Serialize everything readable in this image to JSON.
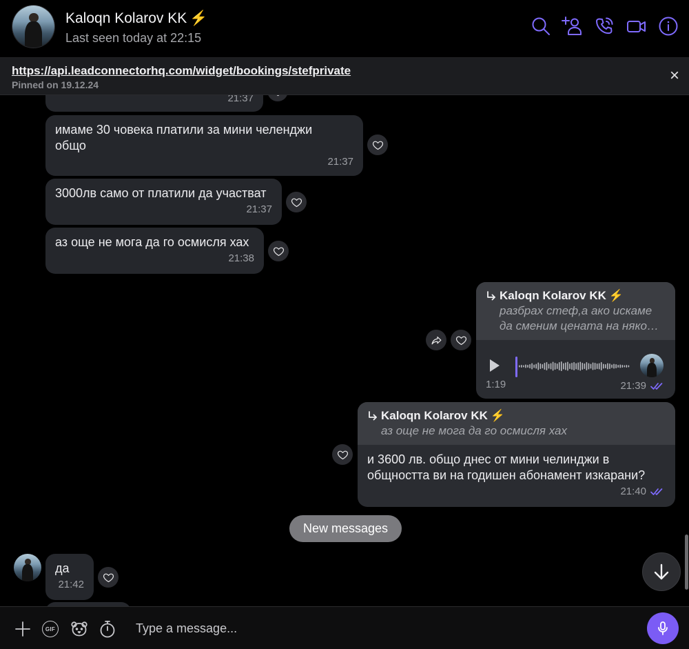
{
  "theme": {
    "accent": "#7f6bff",
    "background": "#000000",
    "incoming_bubble": "#25272c",
    "outgoing_bubble": "#2a2c31",
    "reply_block": "#3b3d42",
    "badge_color": "#f6c343",
    "mic_button": "#7b5cf5"
  },
  "header": {
    "contact_name": "Kaloqn Kolarov KK",
    "badge": "⚡",
    "last_seen": "Last seen today at 22:15",
    "actions": [
      "search-icon",
      "add-participant-icon",
      "voice-call-icon",
      "video-call-icon",
      "info-icon"
    ]
  },
  "pinned": {
    "url": "https://api.leadconnectorhq.com/widget/bookings/stefprivate",
    "caption": "Pinned on 19.12.24",
    "close": "×"
  },
  "message_actions": {
    "reaction_icon": "heart-outline-icon",
    "forward_icon": "share-icon"
  },
  "messages": [
    {
      "time": "21:37"
    },
    {
      "text": "имаме 30 човека платили за мини челенджи\nобщо",
      "time": "21:37"
    },
    {
      "text": "3000лв само от платили да участват",
      "time": "21:37"
    },
    {
      "text": "аз още не мога да го осмисля хах",
      "time": "21:38"
    },
    {
      "outgoing": true,
      "reply_to": {
        "name": "Kaloqn Kolarov KK",
        "badge": "⚡",
        "text": "разбрах стеф,а ако искаме\nда сменим цената на няко…"
      },
      "duration": "1:19",
      "time": "21:39",
      "read": true
    },
    {
      "outgoing": true,
      "reply_to": {
        "name": "Kaloqn Kolarov KK",
        "badge": "⚡",
        "text": "аз още не мога да го осмисля хах"
      },
      "text": "и 3600 лв. общо днес от мини челинджи в\nобщността ви на годишен абонамент изкарани?",
      "time": "21:40",
      "read": true
    },
    {
      "text": "да",
      "time": "21:42"
    }
  ],
  "divider": {
    "new_messages": "New messages"
  },
  "composer": {
    "placeholder": "Type a message...",
    "gif_label": "GIF",
    "tools": [
      "plus-icon",
      "gif-icon",
      "sticker-icon",
      "timer-icon"
    ],
    "send_icon": "microphone-icon"
  }
}
